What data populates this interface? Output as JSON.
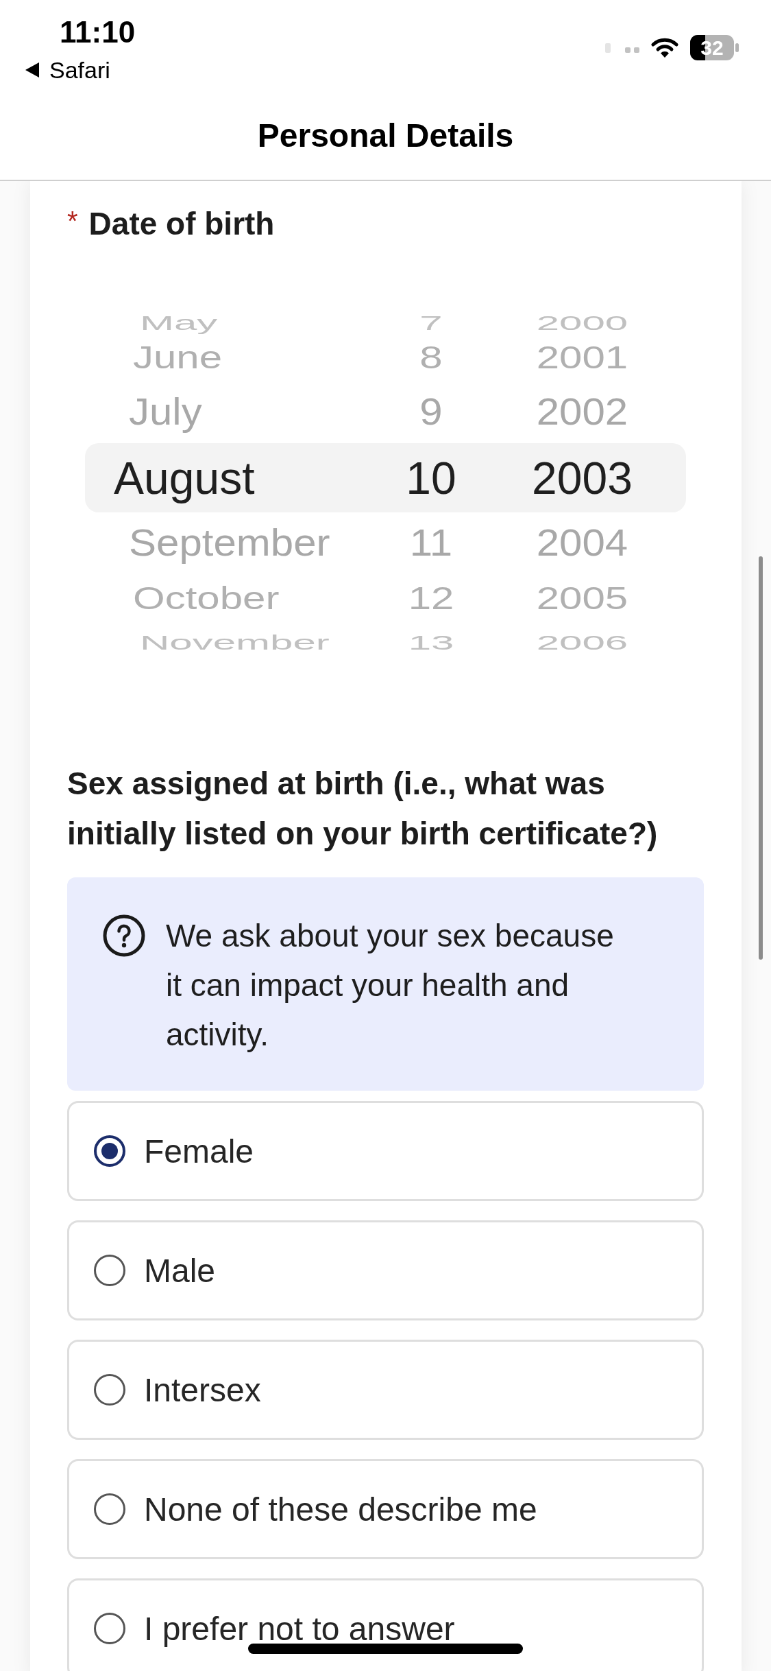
{
  "status_bar": {
    "time": "11:10",
    "back_label": "Safari",
    "battery": "32"
  },
  "nav_bar": {
    "title": "Personal Details"
  },
  "date_of_birth": {
    "required_mark": "*",
    "label": "Date of birth",
    "picker": {
      "rows": [
        {
          "month": "May",
          "day": "7",
          "year": "2000",
          "selected": false
        },
        {
          "month": "June",
          "day": "8",
          "year": "2001",
          "selected": false
        },
        {
          "month": "July",
          "day": "9",
          "year": "2002",
          "selected": false
        },
        {
          "month": "August",
          "day": "10",
          "year": "2003",
          "selected": true
        },
        {
          "month": "September",
          "day": "11",
          "year": "2004",
          "selected": false
        },
        {
          "month": "October",
          "day": "12",
          "year": "2005",
          "selected": false
        },
        {
          "month": "November",
          "day": "13",
          "year": "2006",
          "selected": false
        }
      ]
    }
  },
  "sex_question": {
    "label": "Sex assigned at birth (i.e., what was initially listed on your birth certificate?)",
    "info": {
      "text": "We ask about your sex because it can impact your health and activity."
    },
    "options": [
      {
        "label": "Female",
        "selected": true
      },
      {
        "label": "Male",
        "selected": false
      },
      {
        "label": "Intersex",
        "selected": false
      },
      {
        "label": "None of these describe me",
        "selected": false
      },
      {
        "label": "I prefer not to answer",
        "selected": false
      }
    ]
  }
}
